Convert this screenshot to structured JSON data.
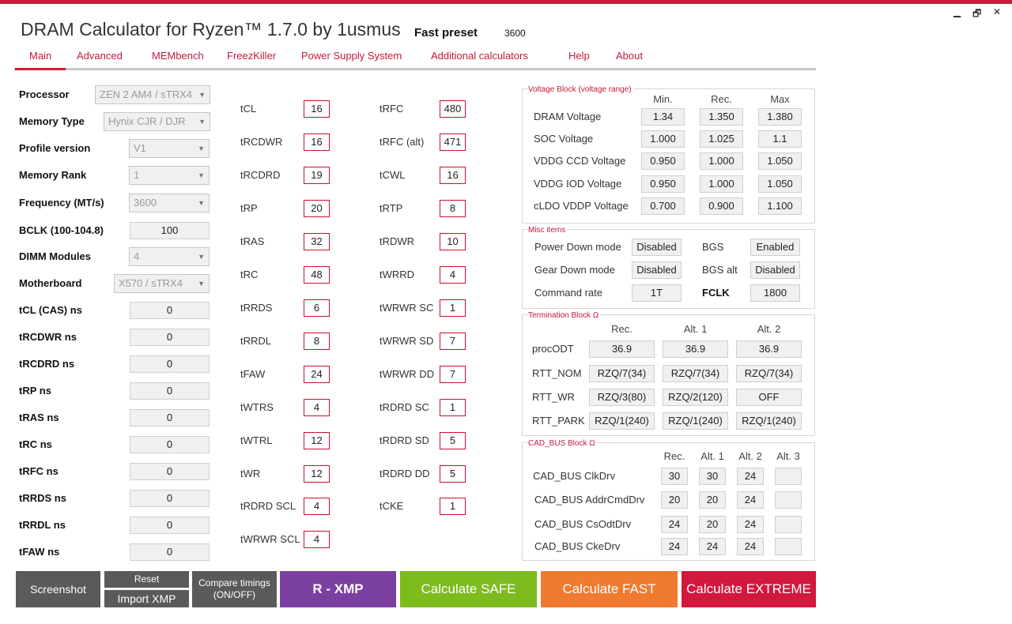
{
  "window": {
    "title": "DRAM Calculator for Ryzen™ 1.7.0 by 1usmus",
    "preset_label": "Fast preset",
    "preset_value": "3600",
    "controls": {
      "minimize": "▁",
      "restore": "🗗",
      "close": "✕"
    }
  },
  "nav": {
    "tabs": [
      "Main",
      "Advanced",
      "MEMbench",
      "FreezKiller",
      "Power Supply System",
      "Additional calculators",
      "Help",
      "About"
    ],
    "active": "Main"
  },
  "left": {
    "fields": [
      {
        "label": "Processor",
        "value": "ZEN 2 AM4 / sTRX4",
        "type": "combo"
      },
      {
        "label": "Memory Type",
        "value": "Hynix CJR / DJR",
        "type": "combo"
      },
      {
        "label": "Profile version",
        "value": "V1",
        "type": "combo"
      },
      {
        "label": "Memory Rank",
        "value": "1",
        "type": "combo"
      },
      {
        "label": "Frequency (MT/s)",
        "value": "3600",
        "type": "combo"
      },
      {
        "label": "BCLK (100-104.8)",
        "value": "100",
        "type": "box"
      },
      {
        "label": "DIMM Modules",
        "value": "4",
        "type": "combo"
      },
      {
        "label": "Motherboard",
        "value": "X570 / sTRX4",
        "type": "combo"
      },
      {
        "label": "tCL (CAS) ns",
        "value": "0",
        "type": "box"
      },
      {
        "label": "tRCDWR ns",
        "value": "0",
        "type": "box"
      },
      {
        "label": "tRCDRD ns",
        "value": "0",
        "type": "box"
      },
      {
        "label": "tRP ns",
        "value": "0",
        "type": "box"
      },
      {
        "label": "tRAS ns",
        "value": "0",
        "type": "box"
      },
      {
        "label": "tRC ns",
        "value": "0",
        "type": "box"
      },
      {
        "label": "tRFC ns",
        "value": "0",
        "type": "box"
      },
      {
        "label": "tRRDS ns",
        "value": "0",
        "type": "box"
      },
      {
        "label": "tRRDL ns",
        "value": "0",
        "type": "box"
      },
      {
        "label": "tFAW ns",
        "value": "0",
        "type": "box"
      }
    ]
  },
  "timings": {
    "col1": [
      {
        "label": "tCL",
        "value": "16"
      },
      {
        "label": "tRCDWR",
        "value": "16"
      },
      {
        "label": "tRCDRD",
        "value": "19"
      },
      {
        "label": "tRP",
        "value": "20"
      },
      {
        "label": "tRAS",
        "value": "32"
      },
      {
        "label": "tRC",
        "value": "48"
      },
      {
        "label": "tRRDS",
        "value": "6"
      },
      {
        "label": "tRRDL",
        "value": "8"
      },
      {
        "label": "tFAW",
        "value": "24"
      },
      {
        "label": "tWTRS",
        "value": "4"
      },
      {
        "label": "tWTRL",
        "value": "12"
      },
      {
        "label": "tWR",
        "value": "12"
      },
      {
        "label": "tRDRD SCL",
        "value": "4"
      },
      {
        "label": "tWRWR SCL",
        "value": "4"
      }
    ],
    "col2": [
      {
        "label": "tRFC",
        "value": "480"
      },
      {
        "label": "tRFC (alt)",
        "value": "471"
      },
      {
        "label": "tCWL",
        "value": "16"
      },
      {
        "label": "tRTP",
        "value": "8"
      },
      {
        "label": "tRDWR",
        "value": "10"
      },
      {
        "label": "tWRRD",
        "value": "4"
      },
      {
        "label": "tWRWR SC",
        "value": "1"
      },
      {
        "label": "tWRWR SD",
        "value": "7"
      },
      {
        "label": "tWRWR DD",
        "value": "7"
      },
      {
        "label": "tRDRD SC",
        "value": "1"
      },
      {
        "label": "tRDRD SD",
        "value": "5"
      },
      {
        "label": "tRDRD DD",
        "value": "5"
      },
      {
        "label": "tCKE",
        "value": "1"
      }
    ]
  },
  "voltage": {
    "title": "Voltage Block (voltage range)",
    "headers": [
      "Min.",
      "Rec.",
      "Max"
    ],
    "rows": [
      {
        "label": "DRAM Voltage",
        "values": [
          "1.34",
          "1.350",
          "1.380"
        ]
      },
      {
        "label": "SOC Voltage",
        "values": [
          "1.000",
          "1.025",
          "1.1"
        ]
      },
      {
        "label": "VDDG  CCD Voltage",
        "values": [
          "0.950",
          "1.000",
          "1.050"
        ]
      },
      {
        "label": "VDDG  IOD Voltage",
        "values": [
          "0.950",
          "1.000",
          "1.050"
        ]
      },
      {
        "label": "cLDO VDDP Voltage",
        "values": [
          "0.700",
          "0.900",
          "1.100"
        ]
      }
    ]
  },
  "misc": {
    "title": "Misc items",
    "rows": [
      {
        "label": "Power Down mode",
        "value": "Disabled",
        "label2": "BGS",
        "value2": "Enabled"
      },
      {
        "label": "Gear Down mode",
        "value": "Disabled",
        "label2": "BGS alt",
        "value2": "Disabled"
      },
      {
        "label": "Command rate",
        "value": "1T",
        "label2": "FCLK",
        "value2": "1800"
      }
    ]
  },
  "termination": {
    "title": "Termination Block Ω",
    "headers": [
      "Rec.",
      "Alt. 1",
      "Alt. 2"
    ],
    "rows": [
      {
        "label": "procODT",
        "values": [
          "36.9",
          "36.9",
          "36.9"
        ]
      },
      {
        "label": "RTT_NOM",
        "values": [
          "RZQ/7(34)",
          "RZQ/7(34)",
          "RZQ/7(34)"
        ]
      },
      {
        "label": "RTT_WR",
        "values": [
          "RZQ/3(80)",
          "RZQ/2(120)",
          "OFF"
        ]
      },
      {
        "label": "RTT_PARK",
        "values": [
          "RZQ/1(240)",
          "RZQ/1(240)",
          "RZQ/1(240)"
        ]
      }
    ]
  },
  "cadbus": {
    "title": "CAD_BUS Block Ω",
    "headers": [
      "Rec.",
      "Alt. 1",
      "Alt. 2",
      "Alt. 3"
    ],
    "rows": [
      {
        "label": "CAD_BUS ClkDrv",
        "values": [
          "30",
          "30",
          "24",
          ""
        ]
      },
      {
        "label": "CAD_BUS AddrCmdDrv",
        "values": [
          "20",
          "20",
          "24",
          ""
        ]
      },
      {
        "label": "CAD_BUS CsOdtDrv",
        "values": [
          "24",
          "20",
          "24",
          ""
        ]
      },
      {
        "label": "CAD_BUS CkeDrv",
        "values": [
          "24",
          "24",
          "24",
          ""
        ]
      }
    ]
  },
  "buttons": {
    "screenshot": "Screenshot",
    "reset": "Reset",
    "import_xmp": "Import XMP",
    "compare": "Compare timings\n(ON/OFF)",
    "rxmp": "R - XMP",
    "safe": "Calculate SAFE",
    "fast": "Calculate FAST",
    "extreme": "Calculate EXTREME"
  },
  "colors": {
    "accent": "#d3173d",
    "safe": "#7dbb1e",
    "fast": "#f07a30",
    "extreme": "#d3173d",
    "rxmp": "#7b3fa2",
    "grey_button": "#5a5a5a"
  }
}
